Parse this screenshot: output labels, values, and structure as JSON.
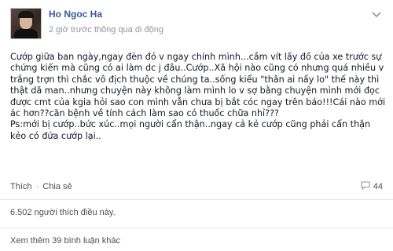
{
  "post": {
    "author": "Ho Ngoc Ha",
    "meta": "2 giờ trước thông qua di động",
    "lines": [
      "Cướp giữa ban ngày,ngay đèn đỏ v ngay chính mình...cầm vít lấy đồ của xe trước sự",
      "chứng kiến mà cũng có ai làm dc j đâu..Cướp..Xã hội nào cũng có nhưng quá nhiều v",
      "trắng trợn thì chắc vô địch thuộc về chúng ta..sống kiểu \"thân ai nấy lo\" thế này thì",
      "thật dã man..nhưng chuyện này không làm mình lo v sợ bằng chuyện mình mới đọc",
      "được cmt của kgia hỏi sao con mình vẫn chưa bị bắt cóc ngay trên báo!!!Cái nào mới",
      "ác hơn??căn bệnh về tính cách làm sao có thuốc chữa nhỉ???",
      "Ps:mới bị cướp..bức xúc..mọi người cẩn thận..ngay cả kẻ cướp cũng phải cẩn thận",
      "kẻo có đứa cướp lại.."
    ]
  },
  "actions": {
    "like_label": "Thích",
    "separator": "·",
    "share_label": "Chia sẻ",
    "comment_count": "44"
  },
  "likes_text": "6.502 người thích điều này.",
  "more_comments_label": "Xem thêm 39 bình luận khác",
  "icons": {
    "menu": "chevron-down-icon",
    "comments": "comment-bubble-icon"
  },
  "colors": {
    "author_link": "#3b5998",
    "meta_gray": "#90949c",
    "body_text": "#141823"
  }
}
